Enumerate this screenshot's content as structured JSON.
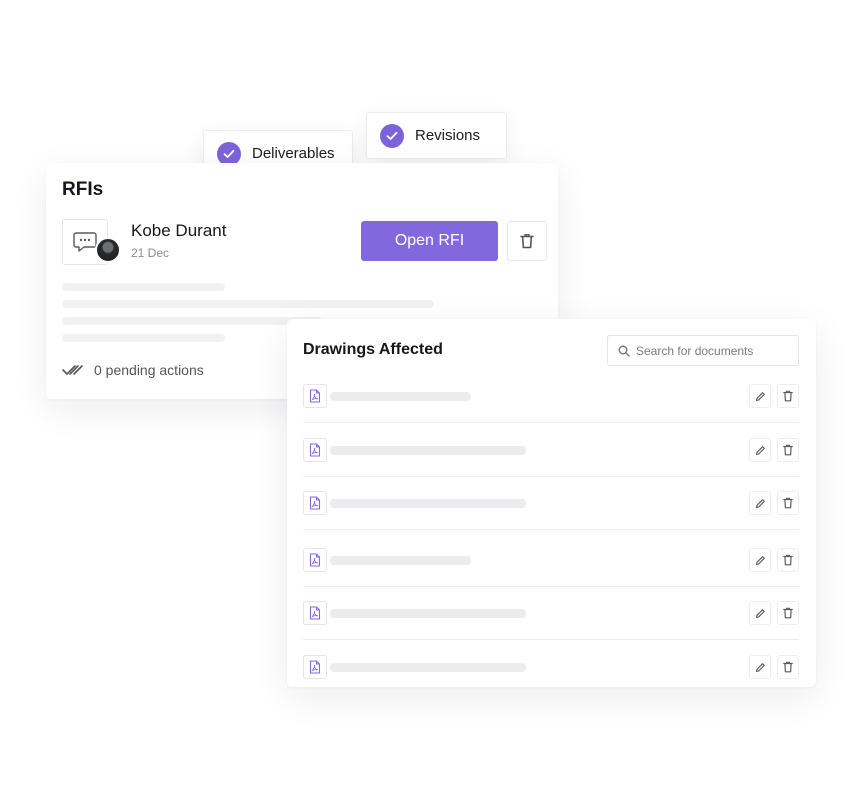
{
  "tags": {
    "deliverables": "Deliverables",
    "revisions": "Revisions"
  },
  "rfi": {
    "title": "RFIs",
    "person_name": "Kobe Durant",
    "date": "21 Dec",
    "open_button": "Open RFI",
    "pending": "0 pending actions"
  },
  "drawings": {
    "title": "Drawings Affected",
    "search_placeholder": "Search for documents",
    "row_count": 6
  },
  "colors": {
    "accent": "#8367dc",
    "skeleton": "#ececef"
  },
  "icons": {
    "check": "check-icon",
    "chat": "chat-bubble-icon",
    "trash": "trash-icon",
    "double_check": "double-check-icon",
    "search": "search-icon",
    "pdf": "pdf-file-icon",
    "edit": "pencil-icon"
  }
}
